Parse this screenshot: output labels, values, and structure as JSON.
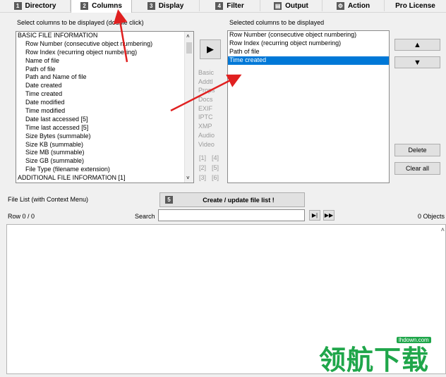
{
  "tabs": [
    {
      "num": "1",
      "label": "Directory"
    },
    {
      "num": "2",
      "label": "Columns"
    },
    {
      "num": "3",
      "label": "Display"
    },
    {
      "num": "4",
      "label": "Filter"
    },
    {
      "label": "Output"
    },
    {
      "label": "Action"
    },
    {
      "label": "Pro License"
    }
  ],
  "left_panel": {
    "title": "Select columns to be displayed (double click)",
    "items": [
      "BASIC FILE INFORMATION",
      "Row Number  (consecutive object numbering)",
      "Row Index  (recurring object numbering)",
      "Name of file",
      "Path of file",
      "Path and Name of file",
      "Date created",
      "Time created",
      "Date modified",
      "Time modified",
      "Date last accessed [5]",
      "Time last accessed [5]",
      "Size Bytes  (summable)",
      "Size KB  (summable)",
      "Size MB  (summable)",
      "Size GB  (summable)",
      "File Type  (filename extension)",
      "ADDITIONAL FILE INFORMATION [1]"
    ]
  },
  "add_button": {
    "icon": "play-icon",
    "glyph": "▶"
  },
  "categories": [
    "Basic",
    "Addtl",
    "Props",
    "Docs",
    "EXIF",
    "IPTC",
    "XMP",
    "Audio",
    "Video"
  ],
  "page_links": [
    "[1]",
    "[4]",
    "[2]",
    "[5]",
    "[3]",
    "[6]"
  ],
  "right_panel": {
    "title": "Selected columns to be displayed",
    "items": [
      "Row Number  (consecutive object numbering)",
      "Row Index  (recurring object numbering)",
      "Path of file",
      "Time created"
    ],
    "selected_index": 3
  },
  "side_buttons": {
    "up": "▲",
    "down": "▼",
    "delete": "Delete",
    "clear_all": "Clear all"
  },
  "file_list": {
    "label": "File List (with Context Menu)",
    "create_num": "5",
    "create_label": "Create / update file list !",
    "row_counter": "Row 0 / 0",
    "search_label": "Search",
    "search_value": "",
    "objects_count": "0 Objects"
  },
  "watermark": {
    "text": "领航下载",
    "url": "lhdown.com"
  },
  "colors": {
    "selection": "#0078d7",
    "arrow": "#e02020",
    "watermark": "#1fa64a"
  }
}
